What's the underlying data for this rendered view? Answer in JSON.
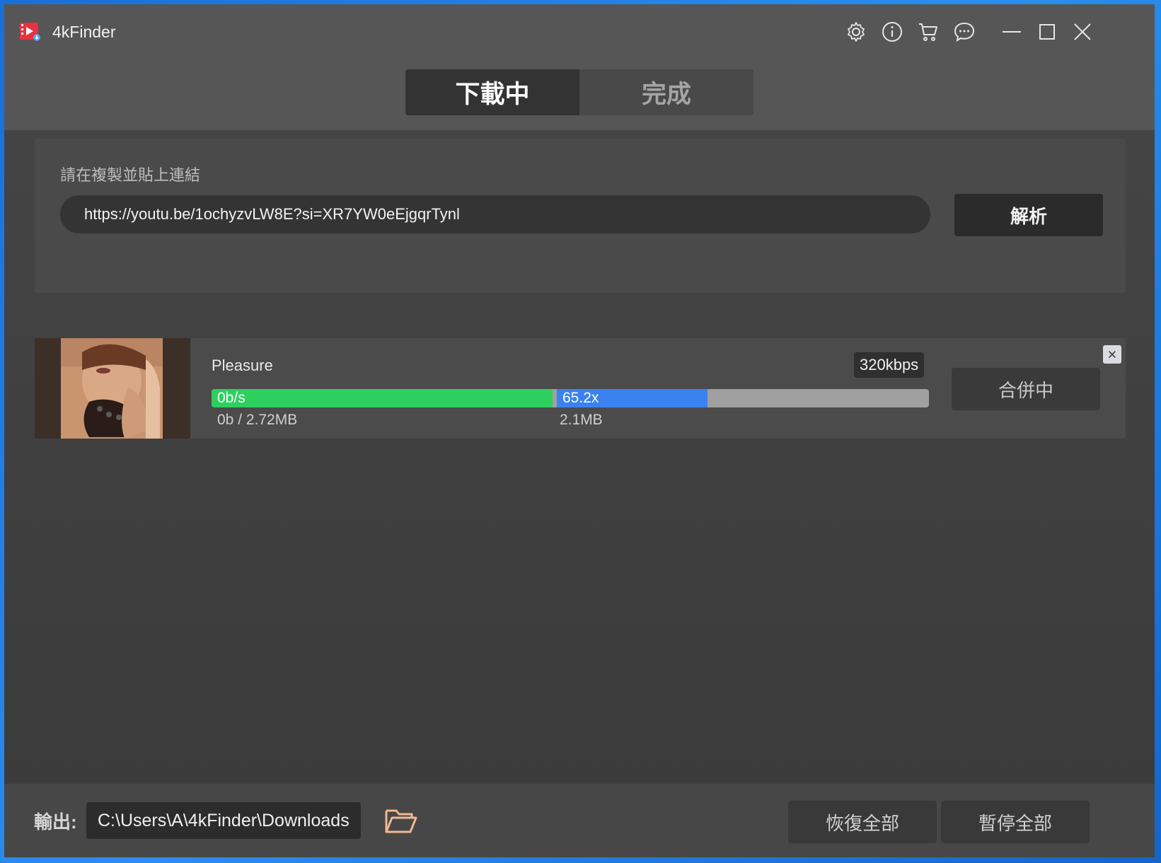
{
  "app": {
    "title": "4kFinder",
    "logo_icon": "video-download-logo-icon"
  },
  "titlebar": {
    "icons": [
      "settings-icon",
      "info-icon",
      "cart-icon",
      "feedback-icon",
      "minimize-icon",
      "maximize-icon",
      "close-icon"
    ]
  },
  "tabs": [
    {
      "label": "下載中",
      "active": true
    },
    {
      "label": "完成",
      "active": false
    }
  ],
  "url_panel": {
    "label": "請在複製並貼上連結",
    "url_value": "https://youtu.be/1ochyzvLW8E?si=XR7YW0eEjgqrTynl",
    "parse_button": "解析"
  },
  "download_item": {
    "title": "Pleasure",
    "quality": "320kbps",
    "speed": "0b/s",
    "ratio": "65.2x",
    "size_progress": "0b / 2.72MB",
    "size_second": "2.1MB",
    "green_fraction": 0.475,
    "blue_fraction": 0.21,
    "status_button": "合併中"
  },
  "footer": {
    "output_label": "輸出:",
    "output_path": "C:\\Users\\A\\4kFinder\\Downloads",
    "resume_all": "恢復全部",
    "pause_all": "暫停全部"
  },
  "colors": {
    "progress_green": "#2dd05f",
    "progress_blue": "#3a82f0",
    "progress_track": "#a0a0a0",
    "folder_outline": "#f1b892"
  }
}
